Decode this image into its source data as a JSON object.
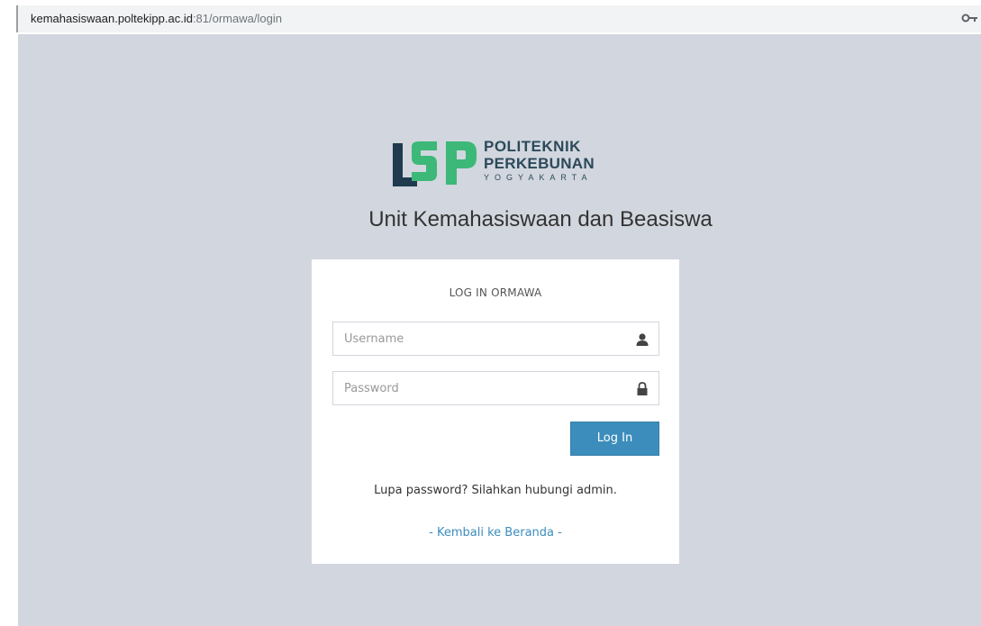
{
  "browser": {
    "url_host": "kemahasiswaan.poltekipp.ac.id",
    "url_rest": ":81/ormawa/login"
  },
  "logo": {
    "line1": "POLITEKNIK",
    "line2": "PERKEBUNAN",
    "line3": "YOGYAKARTA",
    "icons": [
      "key-icon",
      "user-icon",
      "lock-icon"
    ]
  },
  "heading": "Unit Kemahasiswaan dan Beasiswa",
  "login": {
    "title": "LOG IN ORMAWA",
    "username_placeholder": "Username",
    "username_value": "",
    "password_placeholder": "Password",
    "password_value": "",
    "button_label": "Log In",
    "forgot_text": "Lupa password? Silahkan hubungi admin.",
    "back_link": "- Kembali ke Beranda -"
  },
  "colors": {
    "page_bg": "#d2d6de",
    "primary": "#3c8dbc",
    "logo_dark": "#1f3b4d",
    "logo_green": "#3cb878"
  }
}
